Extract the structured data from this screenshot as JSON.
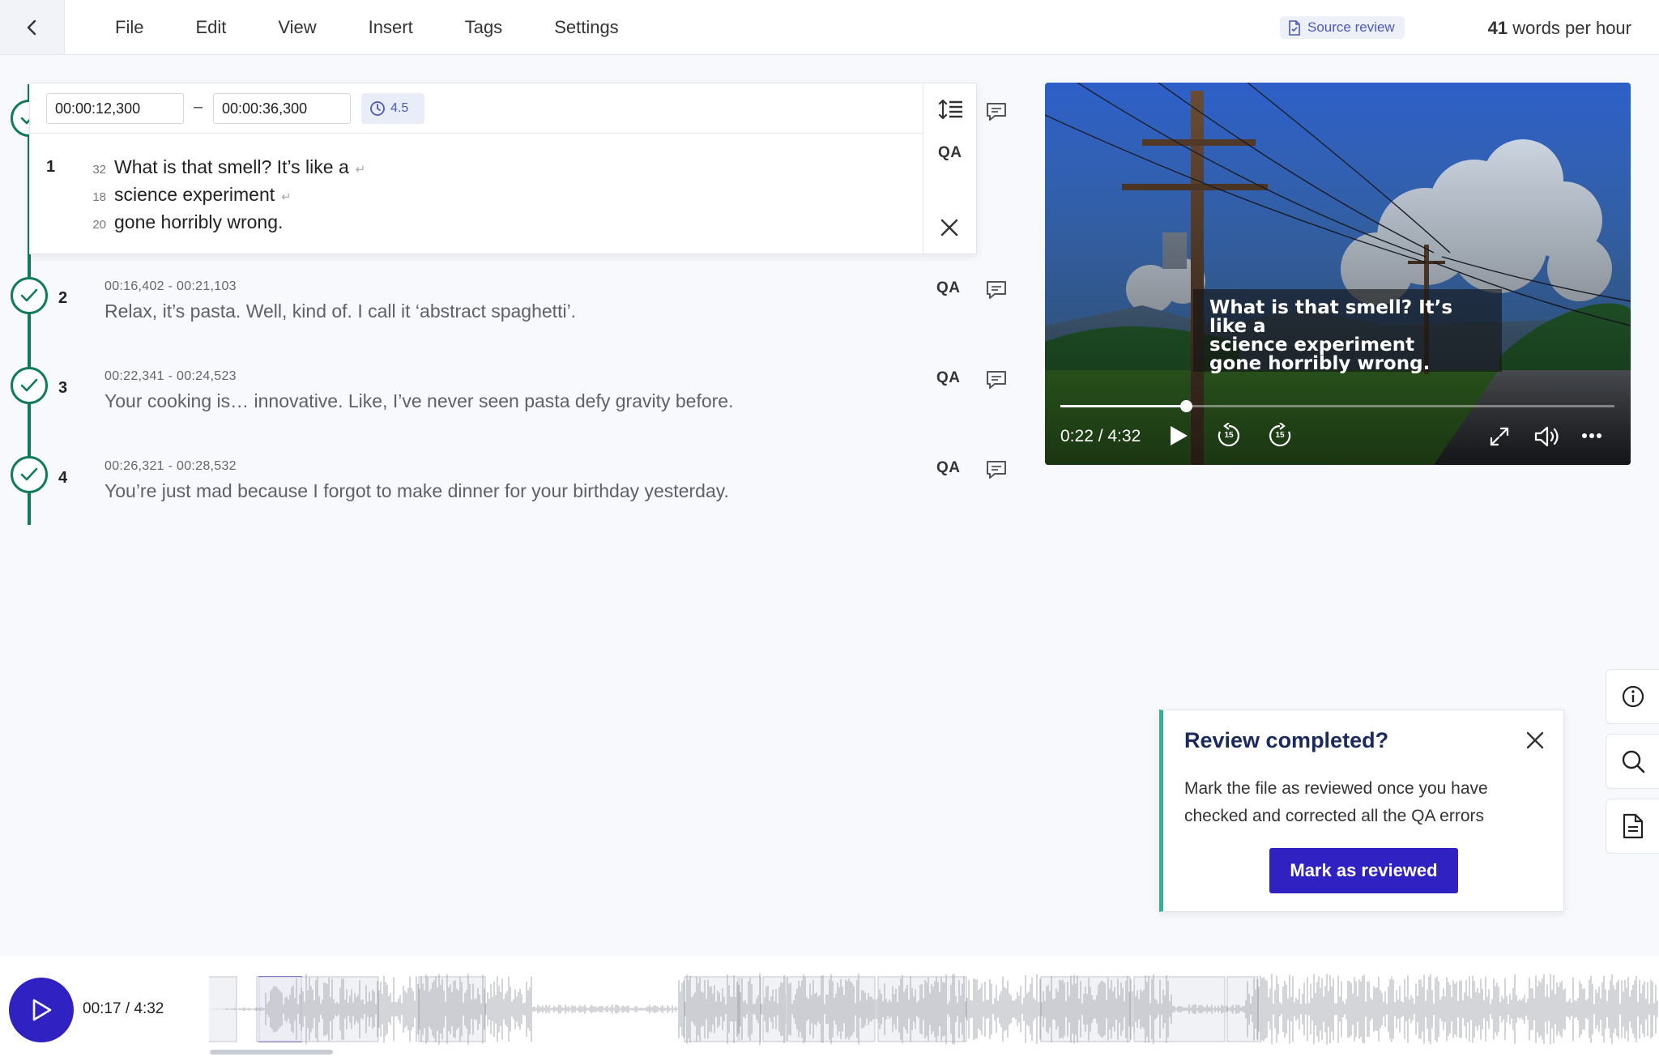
{
  "menu": {
    "items": [
      "File",
      "Edit",
      "View",
      "Insert",
      "Tags",
      "Settings"
    ],
    "source_review": "Source review",
    "wph_count": "41",
    "wph_label": "words per hour"
  },
  "active_segment": {
    "number": "1",
    "start": "00:00:12,300",
    "separator": "–",
    "end": "00:00:36,300",
    "duration": "4.5",
    "qa": "QA",
    "lines": [
      {
        "chars": "32",
        "text": "What is that smell? It’s like a"
      },
      {
        "chars": "18",
        "text": "science experiment"
      },
      {
        "chars": "20",
        "text": "gone horribly wrong."
      }
    ],
    "return_glyph": "↵"
  },
  "segments": [
    {
      "number": "2",
      "time": "00:16,402 - 00:21,103",
      "text": "Relax, it’s pasta. Well, kind of. I call it ‘abstract spaghetti’.",
      "qa": "QA"
    },
    {
      "number": "3",
      "time": "00:22,341 - 00:24,523",
      "text": "Your cooking is… innovative. Like, I’ve never seen pasta defy gravity before.",
      "qa": "QA"
    },
    {
      "number": "4",
      "time": "00:26,321 - 00:28,532",
      "text": "You’re just mad because I forgot to make dinner for your birthday yesterday.",
      "qa": "QA"
    }
  ],
  "video": {
    "subtitle_lines": [
      "What is that smell? It’s like a",
      "science experiment",
      "gone horribly wrong."
    ],
    "time": "0:22 / 4:32",
    "progress": 0.226,
    "skip_seconds": "15"
  },
  "review_popup": {
    "title": "Review completed?",
    "body": "Mark the file as reviewed once you have checked and corrected all the QA errors",
    "button": "Mark as reviewed"
  },
  "player": {
    "time": "00:17 / 4:32"
  },
  "colors": {
    "accent": "#3022c2",
    "timeline": "#117a5c",
    "popup_border": "#22b8a0",
    "link": "#4b5bb6"
  }
}
